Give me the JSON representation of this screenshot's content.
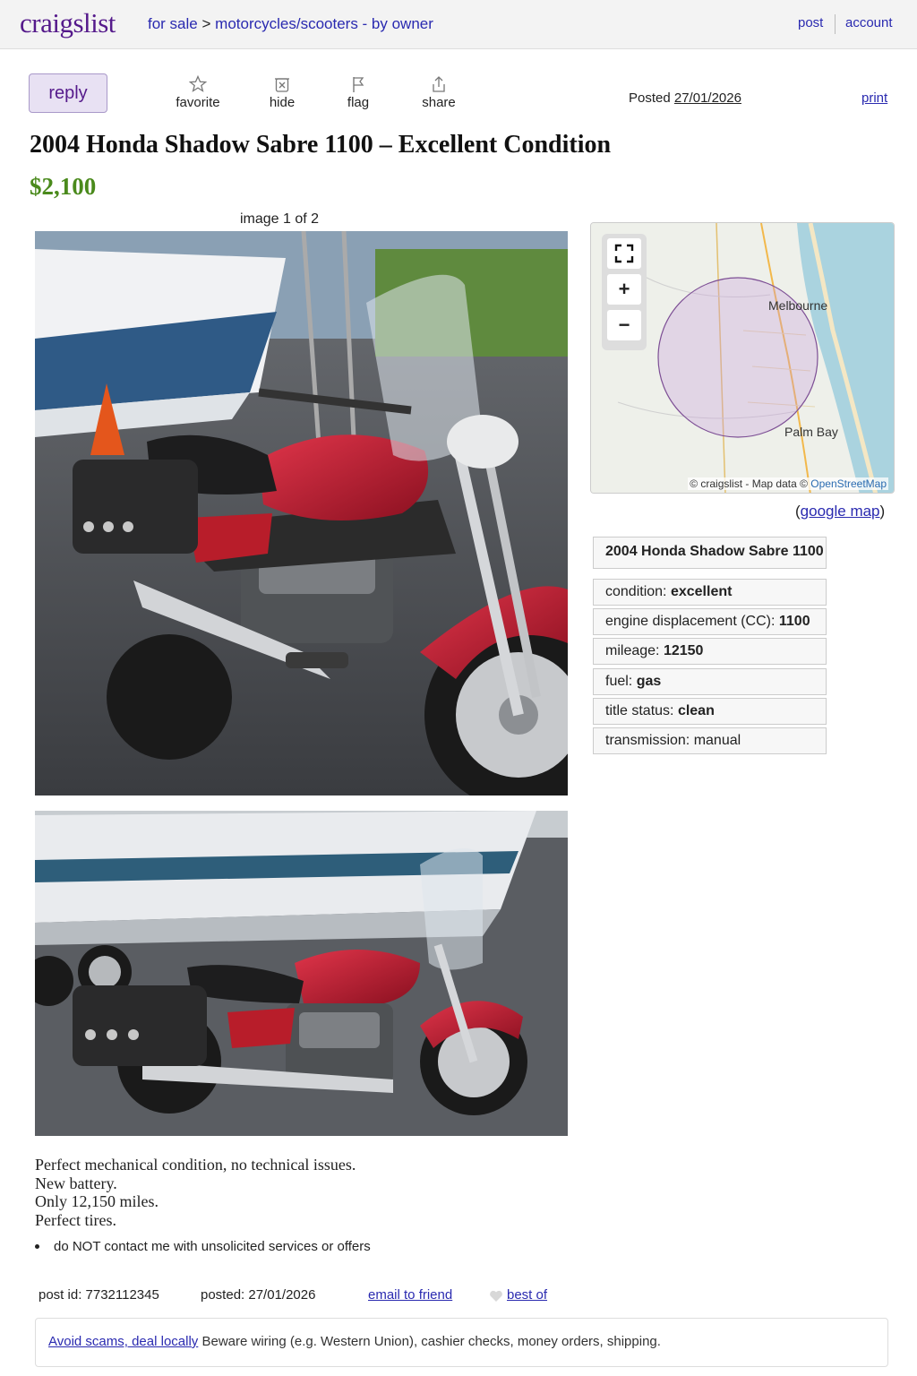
{
  "header": {
    "logo": "craigslist",
    "breadcrumb": [
      "for sale",
      "motorcycles/scooters - by owner"
    ],
    "breadcrumb_sep": ">",
    "nav": [
      "post",
      "account"
    ]
  },
  "actions": {
    "reply": "reply",
    "items": [
      {
        "label": "favorite",
        "icon": "star-icon"
      },
      {
        "label": "hide",
        "icon": "hide-icon"
      },
      {
        "label": "flag",
        "icon": "flag-icon"
      },
      {
        "label": "share",
        "icon": "share-icon"
      }
    ],
    "posted_label": "Posted",
    "posted_date": "27/01/2026",
    "print": "print"
  },
  "listing": {
    "title": "2004 Honda Shadow Sabre 1100 – Excellent Condition",
    "price": "$2,100",
    "image_counter": "image 1 of 2"
  },
  "map": {
    "labels": [
      "Melbourne",
      "Palm Bay"
    ],
    "attribution_prefix": "© craigslist - Map data ©",
    "attribution_link": "OpenStreetMap",
    "google_open": "(",
    "google_link": "google map",
    "google_close": ")",
    "controls": [
      "fullscreen-icon",
      "zoom-in-icon",
      "zoom-out-icon"
    ]
  },
  "attributes": {
    "heading": "2004 Honda Shadow Sabre 1100",
    "rows": [
      {
        "label": "condition:",
        "value": "excellent",
        "bold": true
      },
      {
        "label": "engine displacement (CC):",
        "value": "1100",
        "bold": true
      },
      {
        "label": "mileage:",
        "value": "12150",
        "bold": true
      },
      {
        "label": "fuel:",
        "value": "gas",
        "bold": true
      },
      {
        "label": "title status:",
        "value": "clean",
        "bold": true
      },
      {
        "label": "transmission:",
        "value": "manual",
        "bold": false
      }
    ]
  },
  "description": [
    "Perfect mechanical condition, no technical issues.",
    "New battery.",
    "Only 12,150 miles.",
    "Perfect tires."
  ],
  "notice": "do NOT contact me with unsolicited services or offers",
  "footer": {
    "post_id": "post id: 7732112345",
    "posted": "posted: 27/01/2026",
    "email": "email to friend",
    "best_of": "best of"
  },
  "scam": {
    "link": "Avoid scams, deal locally",
    "text": " Beware wiring (e.g. Western Union), cashier checks, money orders, shipping."
  },
  "colors": {
    "logo": "#551a8b",
    "link": "#2a2ab0",
    "price": "#4a8a1c",
    "reply_bg": "#e8e1f3",
    "motorcycle_red": "#b81d2a"
  }
}
